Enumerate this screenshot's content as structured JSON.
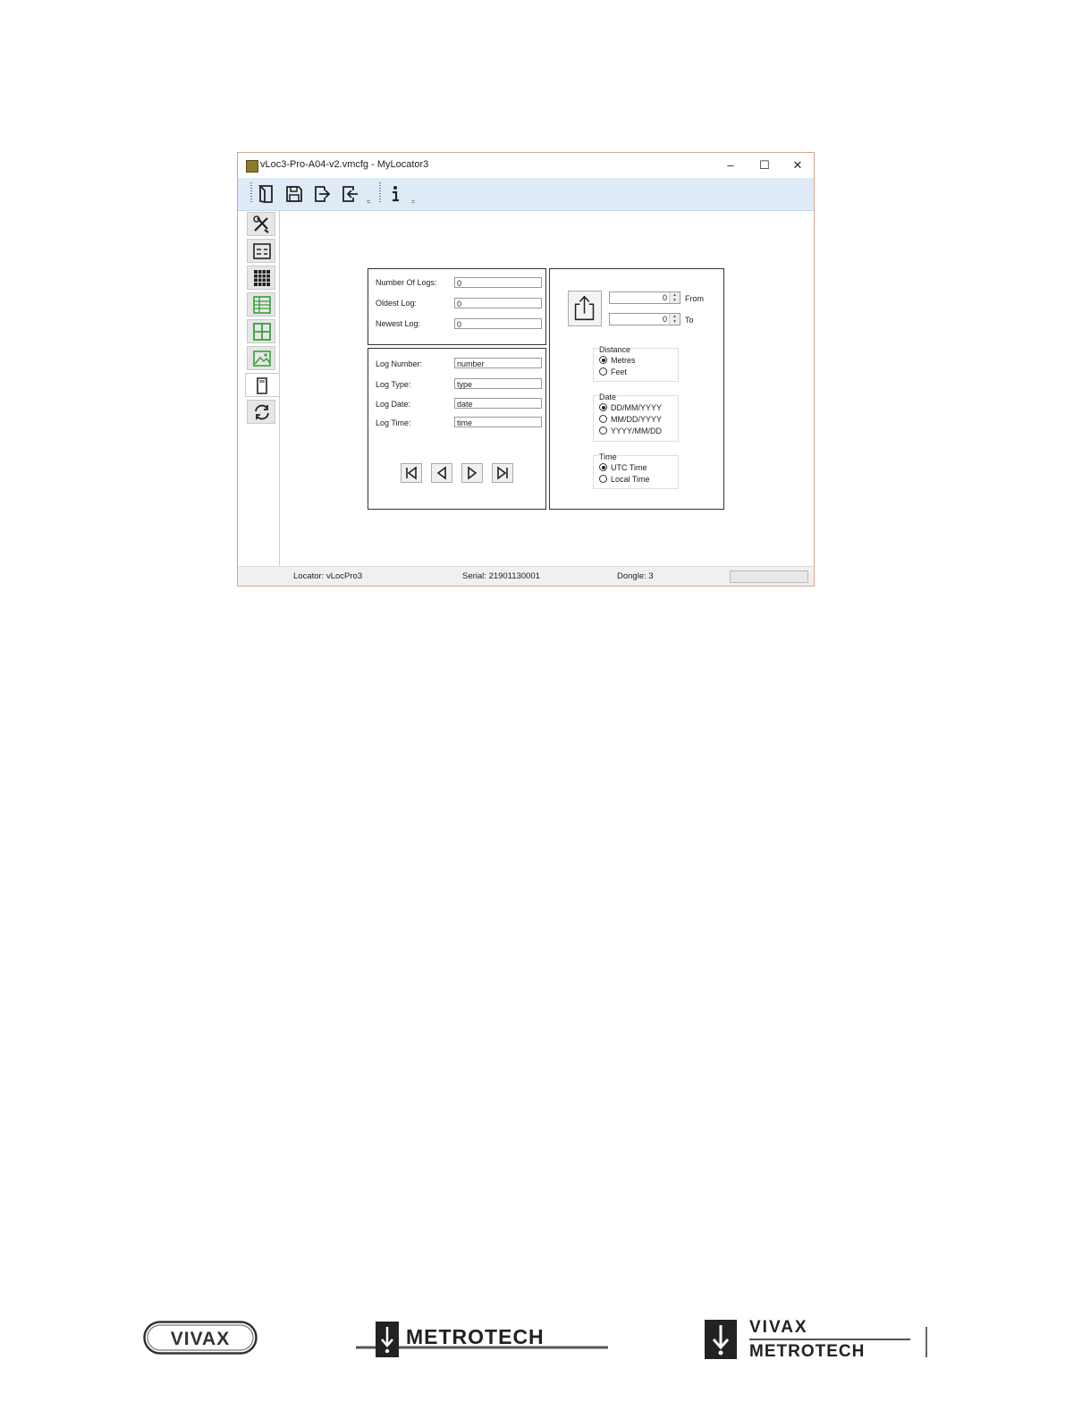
{
  "window": {
    "title": "vLoc3-Pro-A04-v2.vmcfg - MyLocator3",
    "controls": {
      "minimize": "–",
      "maximize": "☐",
      "close": "✕"
    }
  },
  "toolbar": {
    "buttons": [
      {
        "name": "open-file-icon"
      },
      {
        "name": "save-icon"
      },
      {
        "name": "export-icon"
      },
      {
        "name": "import-icon"
      },
      {
        "name": "info-icon"
      }
    ],
    "dropdown_glyph": "="
  },
  "sidebar": {
    "items": [
      {
        "name": "tools-icon",
        "active": false
      },
      {
        "name": "settings-list-icon",
        "active": false
      },
      {
        "name": "grid-icon",
        "active": false
      },
      {
        "name": "table-green-icon",
        "active": false
      },
      {
        "name": "layout-green-icon",
        "active": false
      },
      {
        "name": "image-green-icon",
        "active": false
      },
      {
        "name": "sd-card-icon",
        "active": true
      },
      {
        "name": "sync-icon",
        "active": false
      }
    ]
  },
  "summary": {
    "number_of_logs_label": "Number Of Logs:",
    "number_of_logs_value": "0",
    "oldest_log_label": "Oldest Log:",
    "oldest_log_value": "0",
    "newest_log_label": "Newest Log:",
    "newest_log_value": "0"
  },
  "log_detail": {
    "log_number_label": "Log Number:",
    "log_number_value": "number",
    "log_type_label": "Log Type:",
    "log_type_value": "type",
    "log_date_label": "Log Date:",
    "log_date_value": "date",
    "log_time_label": "Log Time:",
    "log_time_value": "time"
  },
  "export": {
    "from_value": "0",
    "from_label": "From",
    "to_value": "0",
    "to_label": "To",
    "distance": {
      "title": "Distance",
      "options": [
        "Metres",
        "Feet"
      ],
      "selected": 0
    },
    "date": {
      "title": "Date",
      "options": [
        "DD/MM/YYYY",
        "MM/DD/YYYY",
        "YYYY/MM/DD"
      ],
      "selected": 0
    },
    "time": {
      "title": "Time",
      "options": [
        "UTC Time",
        "Local Time"
      ],
      "selected": 0
    }
  },
  "status": {
    "locator": "Locator:  vLocPro3",
    "serial": "Serial:  21901130001",
    "dongle": "Dongle:  3"
  },
  "logos": {
    "vivax": "VIVAX",
    "metrotech": "METROTECH",
    "combined_top": "VIVAX",
    "combined_bottom": "METROTECH"
  }
}
